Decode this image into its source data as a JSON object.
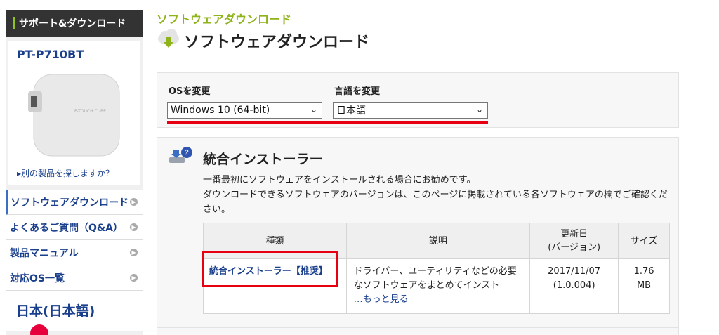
{
  "sidebar": {
    "header": "サポート&ダウンロード",
    "product_name": "PT-P710BT",
    "product_img_text": "P-TOUCH CUBE",
    "other_product_link": "別の製品を探しますか？",
    "menu": [
      {
        "label": "ソフトウェアダウンロード"
      },
      {
        "label": "よくあるご質問（Q&A）"
      },
      {
        "label": "製品マニュアル"
      },
      {
        "label": "対応OS一覧"
      }
    ],
    "region": "日本(日本語)"
  },
  "main": {
    "breadcrumb": "ソフトウェアダウンロード",
    "title": "ソフトウェアダウンロード",
    "os_label": "OSを変更",
    "os_value": "Windows 10 (64-bit)",
    "lang_label": "言語を変更",
    "lang_value": "日本語",
    "installer": {
      "title": "統合インストーラー",
      "desc_line1": "一番最初にソフトウェアをインストールされる場合にお勧めです。",
      "desc_line2": "ダウンロードできるソフトウェアのバージョンは、このページに掲載されている各ソフトウェアの欄でご確認ください。",
      "table": {
        "headers": [
          "種類",
          "説明",
          "更新日\n(バージョン)",
          "サイズ"
        ],
        "header_update_1": "更新日",
        "header_update_2": "(バージョン)",
        "row": {
          "name": "統合インストーラー【推奨】",
          "desc": "ドライバー、ユーティリティなどの必要なソフトウェアをまとめてインスト",
          "more": "…もっと見る",
          "date": "2017/11/07",
          "version": "(1.0.004)",
          "size_1": "1.76",
          "size_2": "MB"
        }
      }
    }
  },
  "colors": {
    "accent_green": "#8fb31a",
    "link_blue": "#1a3f8c",
    "highlight_red": "#e60012"
  }
}
